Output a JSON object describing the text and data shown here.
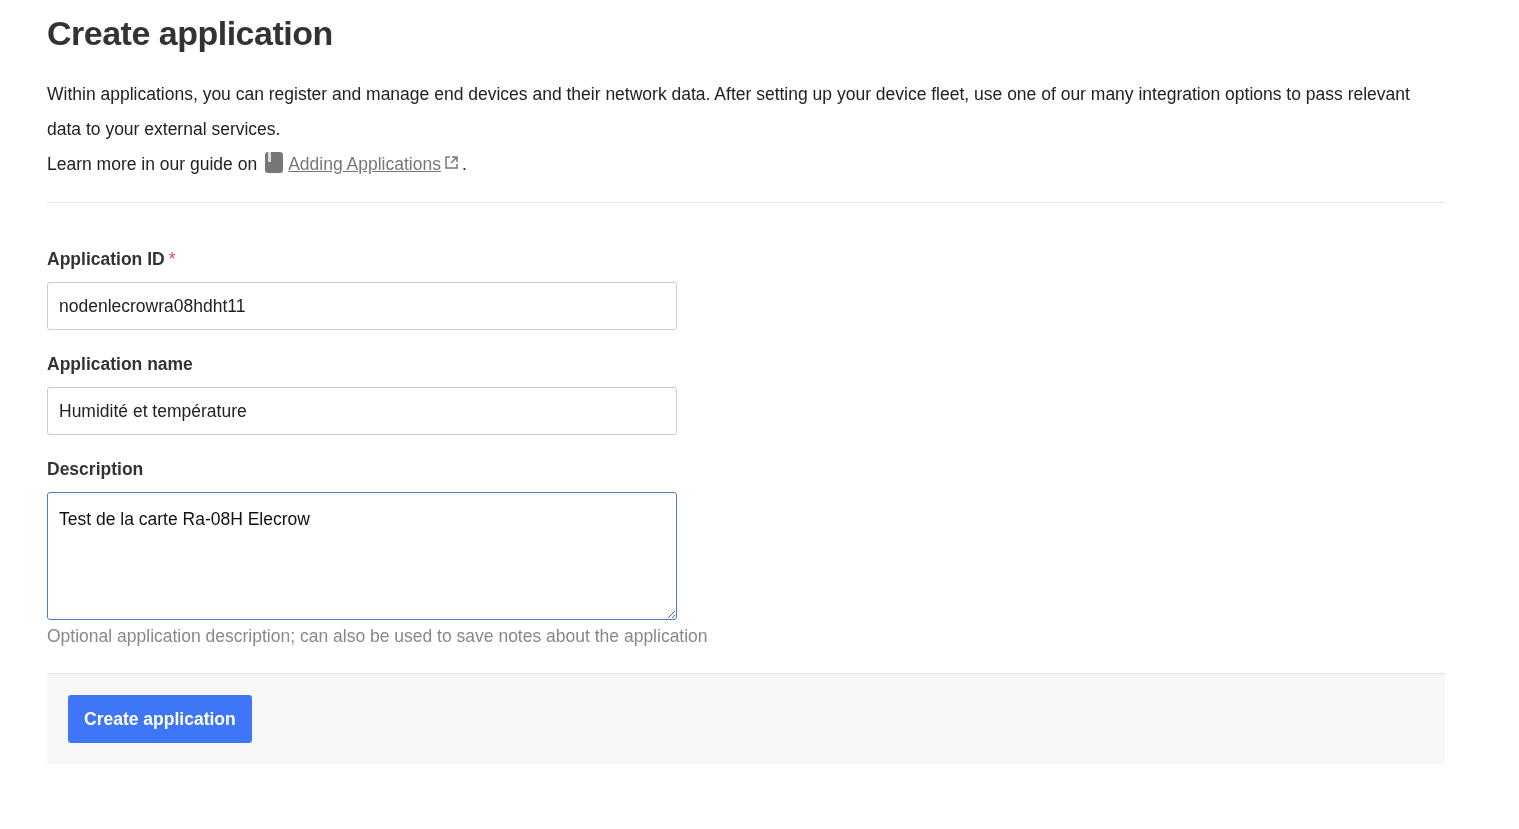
{
  "title": "Create application",
  "intro": "Within applications, you can register and manage end devices and their network data. After setting up your device fleet, use one of our many integration options to pass relevant data to your external services.",
  "guide": {
    "prefix": "Learn more in our guide on",
    "link": "Adding Applications",
    "suffix": "."
  },
  "fields": [
    {
      "kind": "input",
      "label": "Application ID",
      "required": true,
      "value": "nodenlecrowra08hdht11",
      "focused": false
    },
    {
      "kind": "input",
      "label": "Application name",
      "required": false,
      "value": "Humidité et température",
      "focused": false
    },
    {
      "kind": "textarea",
      "label": "Description",
      "required": false,
      "value": "Test de la carte Ra-08H Elecrow",
      "focused": true,
      "hint": "Optional application description; can also be used to save notes about the application"
    }
  ],
  "required_mark": "*",
  "submit": "Create application"
}
